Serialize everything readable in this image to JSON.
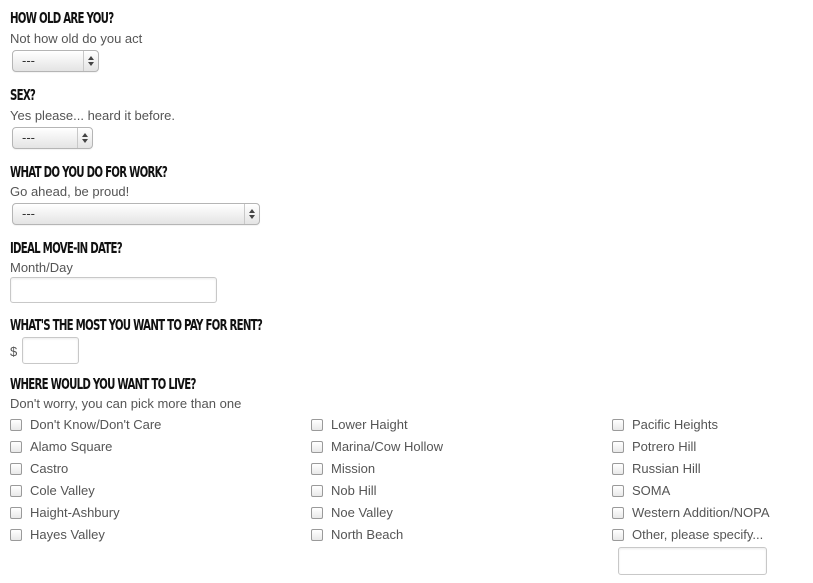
{
  "age": {
    "title": "How old are you?",
    "subtitle": "Not how old do you act",
    "selected": "---"
  },
  "sex": {
    "title": "Sex?",
    "subtitle": "Yes please... heard it before.",
    "selected": "---"
  },
  "work": {
    "title": "What do you do for work?",
    "subtitle": "Go ahead, be proud!",
    "selected": "---"
  },
  "move_in": {
    "title": "Ideal move-in date?",
    "subtitle": "Month/Day",
    "value": ""
  },
  "rent": {
    "title": "What's the most you want to pay for rent?",
    "currency": "$",
    "value": ""
  },
  "neighborhoods": {
    "title": "Where would you want to live?",
    "subtitle": "Don't worry, you can pick more than one",
    "columns": [
      [
        "Don't Know/Don't Care",
        "Alamo Square",
        "Castro",
        "Cole Valley",
        "Haight-Ashbury",
        "Hayes Valley"
      ],
      [
        "Lower Haight",
        "Marina/Cow Hollow",
        "Mission",
        "Nob Hill",
        "Noe Valley",
        "North Beach"
      ],
      [
        "Pacific Heights",
        "Potrero Hill",
        "Russian Hill",
        "SOMA",
        "Western Addition/NOPA",
        "Other, please specify..."
      ]
    ],
    "other_value": ""
  }
}
